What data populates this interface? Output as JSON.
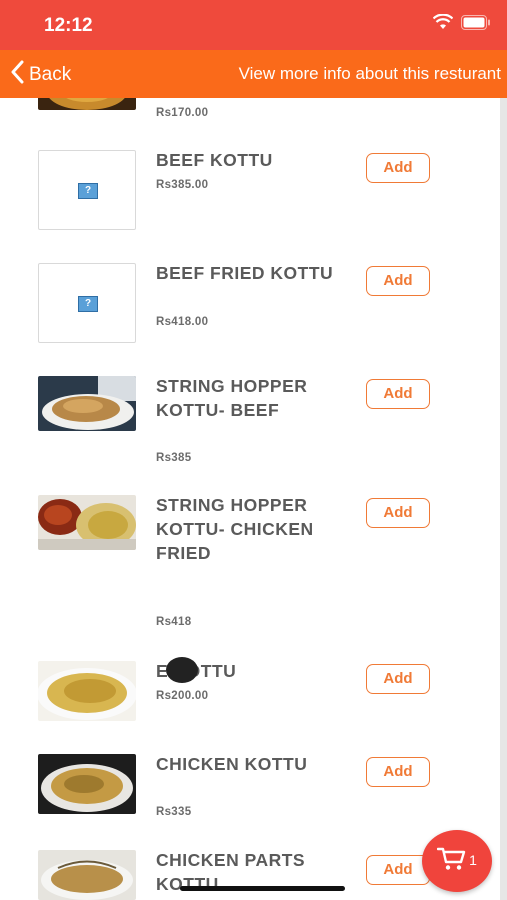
{
  "status": {
    "time": "12:12"
  },
  "nav": {
    "back_label": "Back",
    "more_info_label": "View more info about this resturant"
  },
  "items": [
    {
      "name": "",
      "price": "Rs170.00"
    },
    {
      "name": "BEEF KOTTU",
      "price": "Rs385.00",
      "add_label": "Add"
    },
    {
      "name": "BEEF FRIED KOTTU",
      "price": "Rs418.00",
      "add_label": "Add"
    },
    {
      "name": "STRING HOPPER KOTTU- BEEF",
      "price": "Rs385",
      "add_label": "Add"
    },
    {
      "name": "STRING HOPPER KOTTU- CHICKEN FRIED",
      "price": "Rs418",
      "add_label": "Add"
    },
    {
      "name": "E KOTTU",
      "price": "Rs200.00",
      "add_label": "Add"
    },
    {
      "name": "CHICKEN KOTTU",
      "price": "Rs335",
      "add_label": "Add"
    },
    {
      "name": "CHICKEN PARTS KOTTU",
      "price": "",
      "add_label": "Add"
    }
  ],
  "cart": {
    "count": "1"
  },
  "colors": {
    "status_bar": "#ef4a3c",
    "nav_bar": "#fa6a1a",
    "accent": "#f07a36",
    "fab": "#f0443c"
  },
  "icons": {
    "back": "chevron-left-icon",
    "wifi": "wifi-icon",
    "battery": "battery-icon",
    "cart": "cart-icon",
    "placeholder": "broken-image-icon"
  }
}
